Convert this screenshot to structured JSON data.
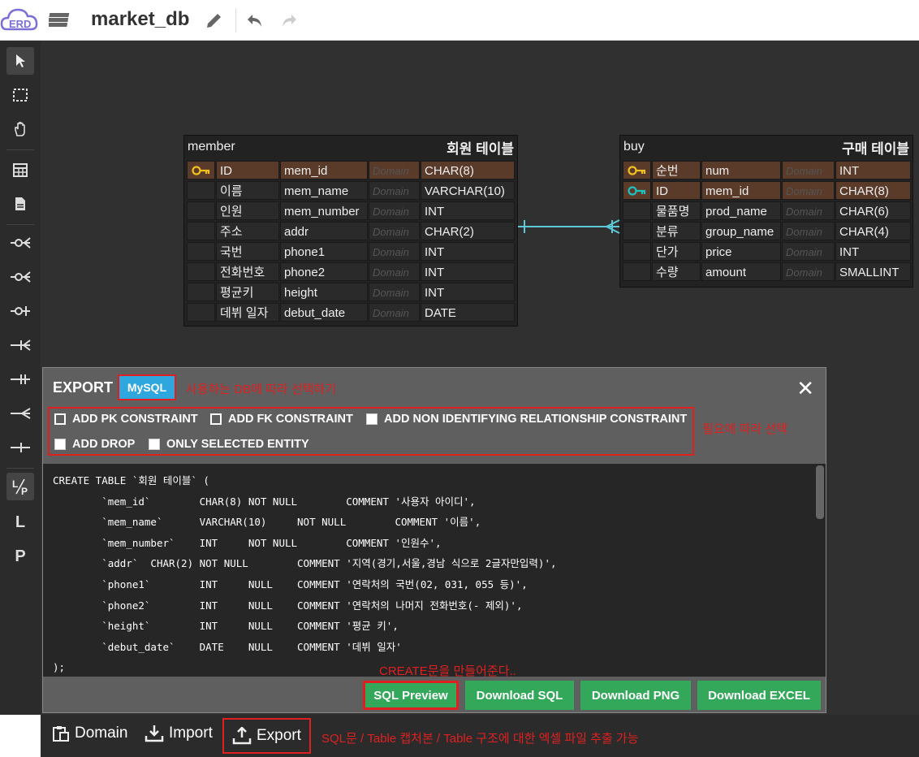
{
  "app": {
    "logo_text": "ERD",
    "title": "market_db"
  },
  "sidebar": {
    "tools": [
      {
        "name": "pointer-tool",
        "glyph": "↖"
      },
      {
        "name": "select-tool",
        "glyph": "⬚"
      },
      {
        "name": "hand-tool",
        "glyph": "✋"
      },
      {
        "name": "table-tool",
        "glyph": "▦"
      },
      {
        "name": "memo-tool",
        "glyph": "▤"
      },
      {
        "name": "rel-zero-many-tool",
        "glyph": "-O<"
      },
      {
        "name": "rel-zero-many-2-tool",
        "glyph": "-O<"
      },
      {
        "name": "rel-zero-one-tool",
        "glyph": "-O|"
      },
      {
        "name": "rel-one-many-tool",
        "glyph": "-|<"
      },
      {
        "name": "rel-one-one-tool",
        "glyph": "-||"
      },
      {
        "name": "rel-many-tool",
        "glyph": "-<"
      },
      {
        "name": "rel-line-tool",
        "glyph": "-|-"
      },
      {
        "name": "logical-physical-toggle",
        "glyph": "L/P"
      },
      {
        "name": "logical-tool",
        "glyph": "L"
      },
      {
        "name": "physical-tool",
        "glyph": "P"
      }
    ]
  },
  "tables": {
    "member": {
      "name": "member",
      "comment": "회원 테이블",
      "rows": [
        {
          "key": "pk",
          "lname": "ID",
          "pname": "mem_id",
          "domain": "Domain",
          "type": "CHAR(8)"
        },
        {
          "key": "",
          "lname": "이름",
          "pname": "mem_name",
          "domain": "Domain",
          "type": "VARCHAR(10)"
        },
        {
          "key": "",
          "lname": "인원",
          "pname": "mem_number",
          "domain": "Domain",
          "type": "INT"
        },
        {
          "key": "",
          "lname": "주소",
          "pname": "addr",
          "domain": "Domain",
          "type": "CHAR(2)"
        },
        {
          "key": "",
          "lname": "국번",
          "pname": "phone1",
          "domain": "Domain",
          "type": "INT"
        },
        {
          "key": "",
          "lname": "전화번호",
          "pname": "phone2",
          "domain": "Domain",
          "type": "INT"
        },
        {
          "key": "",
          "lname": "평균키",
          "pname": "height",
          "domain": "Domain",
          "type": "INT"
        },
        {
          "key": "",
          "lname": "데뷔 일자",
          "pname": "debut_date",
          "domain": "Domain",
          "type": "DATE"
        }
      ]
    },
    "buy": {
      "name": "buy",
      "comment": "구매 테이블",
      "rows": [
        {
          "key": "pk",
          "lname": "순번",
          "pname": "num",
          "domain": "Domain",
          "type": "INT"
        },
        {
          "key": "fk",
          "lname": "ID",
          "pname": "mem_id",
          "domain": "Domain",
          "type": "CHAR(8)"
        },
        {
          "key": "",
          "lname": "물품명",
          "pname": "prod_name",
          "domain": "Domain",
          "type": "CHAR(6)"
        },
        {
          "key": "",
          "lname": "분류",
          "pname": "group_name",
          "domain": "Domain",
          "type": "CHAR(4)"
        },
        {
          "key": "",
          "lname": "단가",
          "pname": "price",
          "domain": "Domain",
          "type": "INT"
        },
        {
          "key": "",
          "lname": "수량",
          "pname": "amount",
          "domain": "Domain",
          "type": "SMALLINT"
        }
      ]
    }
  },
  "export": {
    "title": "EXPORT",
    "db": "MySQL",
    "db_note": "사용하는 DB에 따라 선택하기",
    "options": [
      {
        "label": "ADD PK CONSTRAINT",
        "checked": true
      },
      {
        "label": "ADD FK CONSTRAINT",
        "checked": true
      },
      {
        "label": "ADD NON IDENTIFYING RELATIONSHIP CONSTRAINT",
        "checked": false
      },
      {
        "label": "ADD DROP",
        "checked": false
      },
      {
        "label": "ONLY SELECTED ENTITY",
        "checked": false
      }
    ],
    "options_note": "필요에 따라 선택",
    "sql": "CREATE TABLE `회원 테이블` (\n\t`mem_id`\tCHAR(8)\tNOT NULL\tCOMMENT '사용자 아이디',\n\t`mem_name`\tVARCHAR(10)\tNOT NULL\tCOMMENT '이름',\n\t`mem_number`\tINT\tNOT NULL\tCOMMENT '인원수',\n\t`addr`\tCHAR(2)\tNOT NULL\tCOMMENT '지역(경기,서울,경남 식으로 2글자만입력)',\n\t`phone1`\tINT\tNULL\tCOMMENT '연락처의 국번(02, 031, 055 등)',\n\t`phone2`\tINT\tNULL\tCOMMENT '연락처의 나머지 전화번호(- 제외)',\n\t`height`\tINT\tNULL\tCOMMENT '평균 키',\n\t`debut_date`\tDATE\tNULL\tCOMMENT '데뷔 일자'\n);",
    "create_note": "CREATE문을 만들어준다..",
    "buttons": {
      "sql_preview": "SQL Preview",
      "download_sql": "Download SQL",
      "download_png": "Download PNG",
      "download_excel": "Download EXCEL"
    }
  },
  "bottom": {
    "domain": "Domain",
    "import": "Import",
    "export": "Export",
    "note": "SQL문 / Table 캡처본 / Table 구조에 대한 엑셀 파일 추출 가능"
  },
  "colors": {
    "accent_red": "#e02020",
    "mysql_blue": "#2ea7de",
    "btn_green": "#33a85a",
    "pk_key": "#f0c020",
    "fk_key": "#20c0c0"
  }
}
